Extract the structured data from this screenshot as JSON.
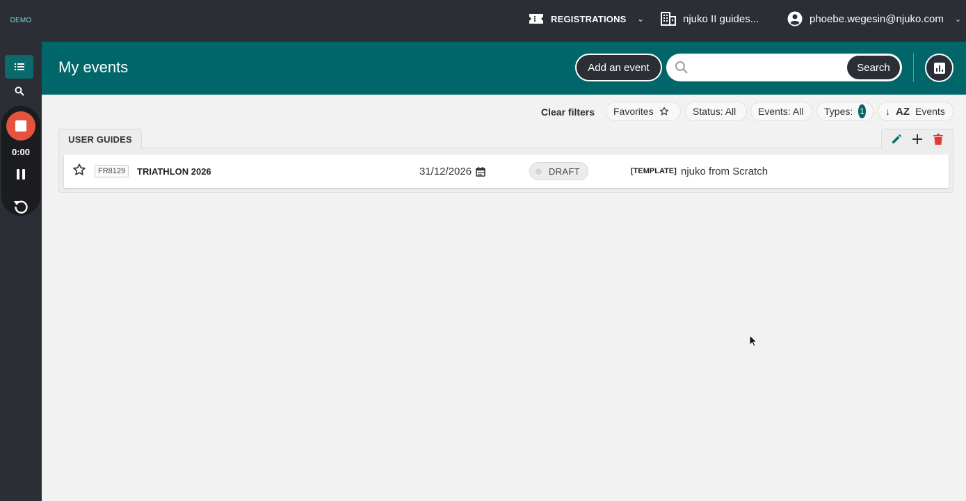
{
  "sidebar": {
    "logo_text": "DEMO",
    "recorder": {
      "time": "0:00"
    }
  },
  "topbar": {
    "registrations_label": "REGISTRATIONS",
    "organization_label": "njuko II guides...",
    "user_email": "phoebe.wegesin@njuko.com"
  },
  "header": {
    "title": "My events",
    "add_event_label": "Add an event",
    "search_placeholder": "",
    "search_label": "Search"
  },
  "filters": {
    "clear_label": "Clear filters",
    "favorites_label": "Favorites",
    "status_label": "Status: All",
    "events_label": "Events: All",
    "types_label": "Types:",
    "types_count": "1",
    "sort_arrow": "↓",
    "sort_az": "AZ",
    "sort_label": "Events"
  },
  "group": {
    "tab_label": "USER GUIDES",
    "events": [
      {
        "code": "FR8129",
        "name": "TRIATHLON 2026",
        "date": "31/12/2026",
        "status": "DRAFT",
        "template_tag": "[TEMPLATE]",
        "template_name": "njuko from Scratch"
      }
    ]
  },
  "colors": {
    "teal": "#00666a",
    "dark": "#2c2e36",
    "record_red": "#e5533f",
    "delete_red": "#e53935"
  }
}
